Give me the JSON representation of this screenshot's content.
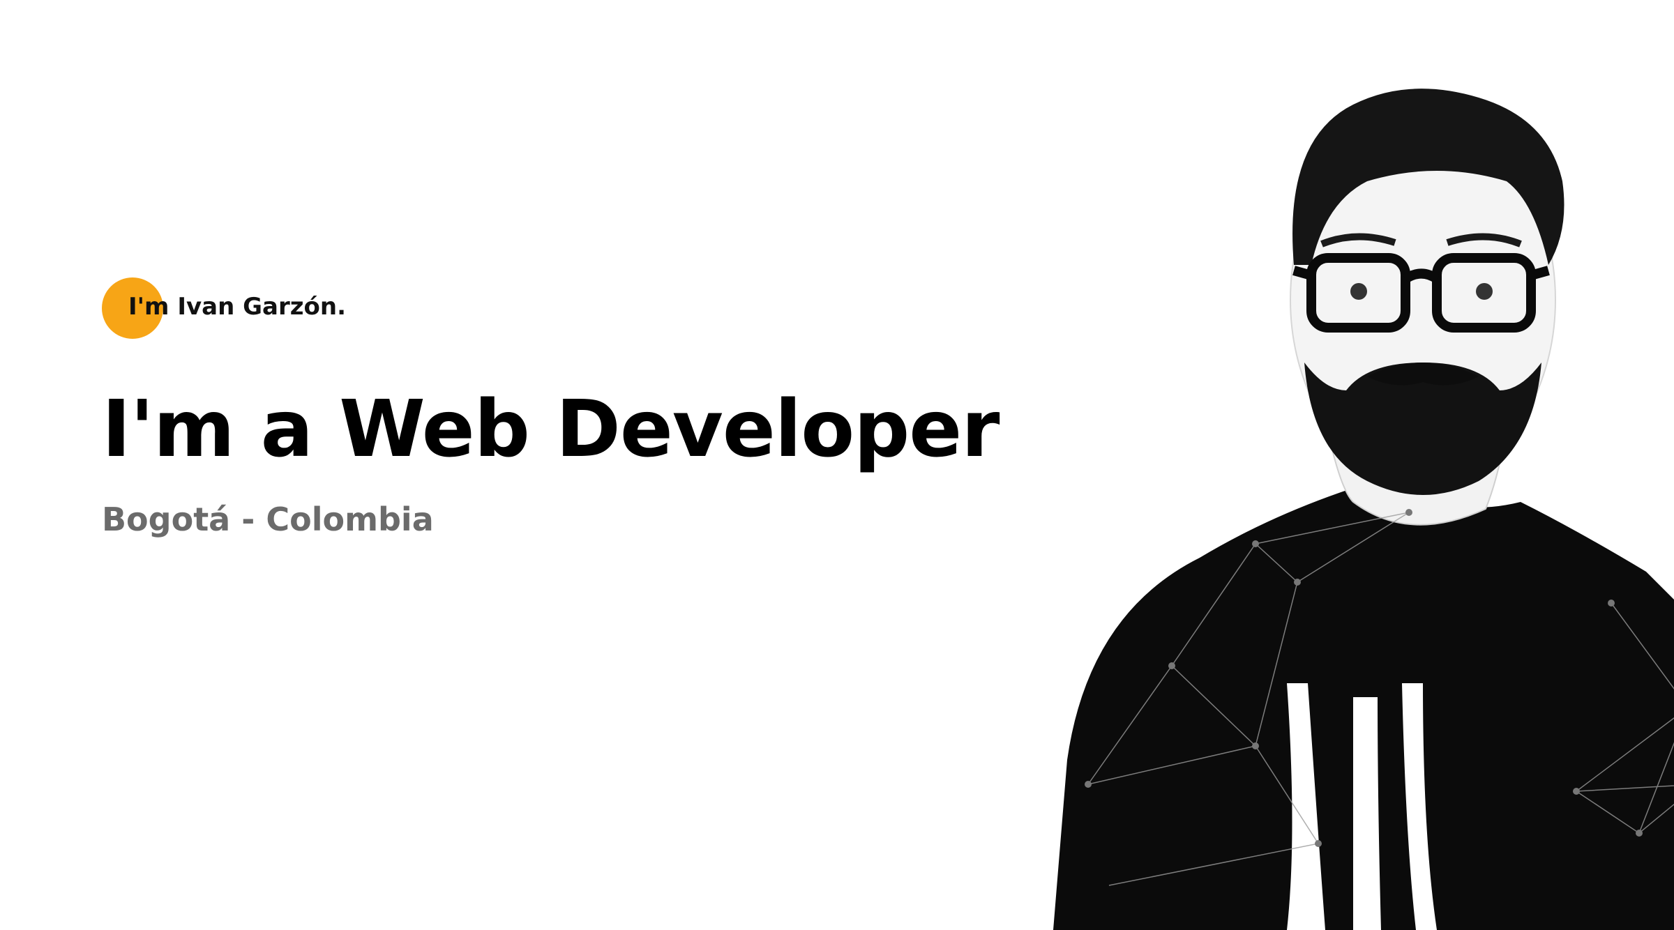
{
  "hero": {
    "intro": "I'm Ivan Garzón.",
    "headline": "I'm a Web Developer",
    "location": "Bogotá - Colombia"
  },
  "colors": {
    "accent": "#f7a516",
    "heading": "#000000",
    "subtle": "#6b6b6b",
    "background": "#ffffff"
  },
  "portrait": {
    "description_icon": "person-photo"
  }
}
